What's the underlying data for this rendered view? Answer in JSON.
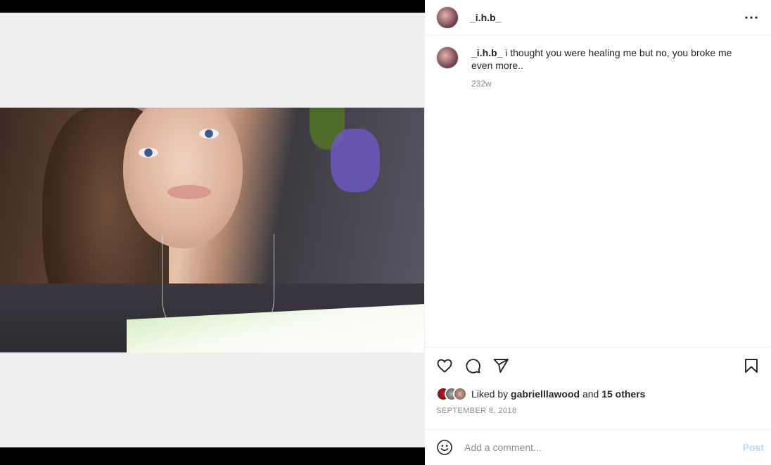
{
  "post": {
    "username": "_i.h.b_",
    "caption_text": "i thought you were healing me but no, you broke me even more..",
    "caption_age": "232w",
    "liked_by_prefix": "Liked by",
    "liked_by_user": "gabrielllawood",
    "liked_by_joiner": "and",
    "liked_by_others": "15 others",
    "date": "SEPTEMBER 8, 2018"
  },
  "comment": {
    "placeholder": "Add a comment...",
    "post_label": "Post"
  },
  "icons": {
    "more": "more-options-icon",
    "like": "heart-icon",
    "comment": "comment-icon",
    "share": "share-icon",
    "save": "bookmark-icon",
    "emoji": "emoji-icon"
  },
  "colors": {
    "text": "#262626",
    "muted": "#8e8e8e",
    "post_disabled": "#b3dbff"
  }
}
